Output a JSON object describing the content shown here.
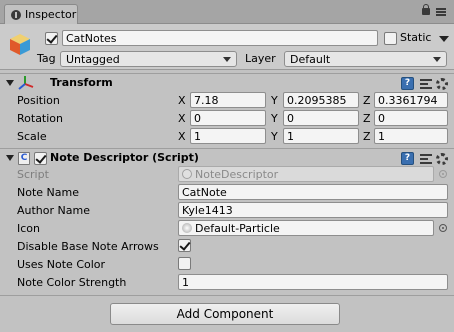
{
  "window": {
    "tab_label": "Inspector"
  },
  "gameobject": {
    "active": true,
    "name": "CatNotes",
    "static_label": "Static",
    "static": false,
    "tag_label": "Tag",
    "tag_value": "Untagged",
    "layer_label": "Layer",
    "layer_value": "Default"
  },
  "transform": {
    "title": "Transform",
    "rows": [
      {
        "label": "Position",
        "x": "7.18",
        "y": "0.2095385",
        "z": "0.3361794"
      },
      {
        "label": "Rotation",
        "x": "0",
        "y": "0",
        "z": "0"
      },
      {
        "label": "Scale",
        "x": "1",
        "y": "1",
        "z": "1"
      }
    ],
    "axis_x": "X",
    "axis_y": "Y",
    "axis_z": "Z"
  },
  "note_descriptor": {
    "title": "Note Descriptor (Script)",
    "enabled": true,
    "fields": {
      "script_label": "Script",
      "script_value": "NoteDescriptor",
      "note_name_label": "Note Name",
      "note_name_value": "CatNote",
      "author_name_label": "Author Name",
      "author_name_value": "Kyle1413",
      "icon_label": "Icon",
      "icon_value": "Default-Particle",
      "disable_arrows_label": "Disable Base Note Arrows",
      "disable_arrows_checked": true,
      "uses_color_label": "Uses Note Color",
      "uses_color_checked": false,
      "color_strength_label": "Note Color Strength",
      "color_strength_value": "1"
    }
  },
  "add_component_label": "Add Component",
  "icons": [
    "info-icon",
    "lock-icon",
    "menu-icon",
    "gameobject-cube-icon",
    "transform-axes-icon",
    "script-icon",
    "help-icon",
    "preset-icon",
    "gear-icon",
    "object-picker-icon",
    "particle-icon"
  ],
  "colors": {
    "panel": "#c2c2c2",
    "tab_bar": "#a5a5a5",
    "help_blue": "#3a6fb0"
  }
}
